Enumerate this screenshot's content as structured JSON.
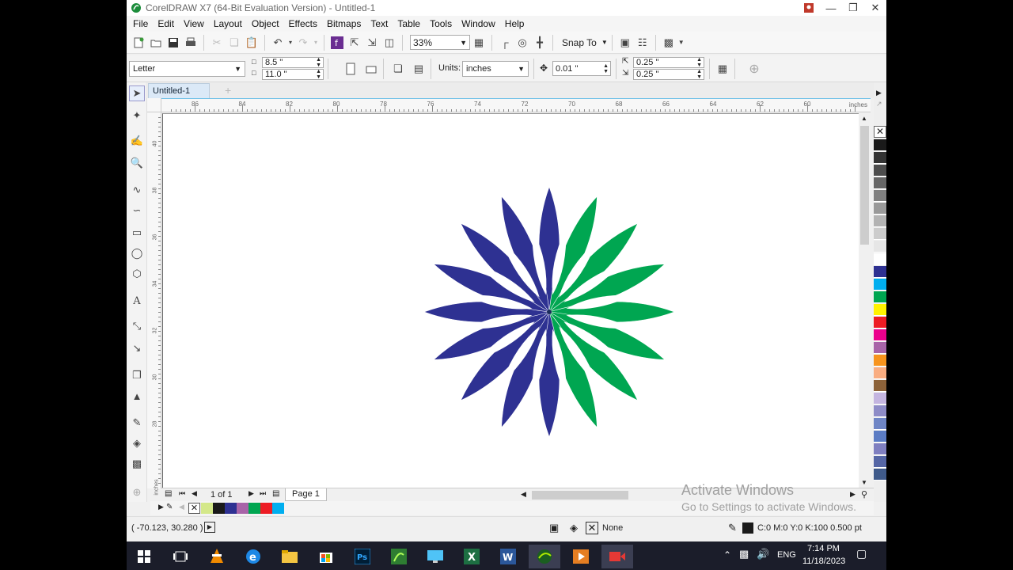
{
  "window": {
    "title": "CorelDRAW X7 (64-Bit Evaluation Version) - Untitled-1"
  },
  "menu": [
    "File",
    "Edit",
    "View",
    "Layout",
    "Object",
    "Effects",
    "Bitmaps",
    "Text",
    "Table",
    "Tools",
    "Window",
    "Help"
  ],
  "toolbar": {
    "zoom": "33%",
    "snap_to": "Snap To"
  },
  "property_bar": {
    "page_size": "Letter",
    "width": "8.5 \"",
    "height": "11.0 \"",
    "units_label": "Units:",
    "units": "inches",
    "nudge": "0.01 \"",
    "dup_x": "0.25 \"",
    "dup_y": "0.25 \""
  },
  "doc_tab": "Untitled-1",
  "ruler": {
    "h_labels": [
      "86",
      "84",
      "82",
      "80",
      "78",
      "76",
      "74",
      "72",
      "70",
      "68",
      "66",
      "64",
      "62",
      "60"
    ],
    "h_unit": "inches",
    "v_labels": [
      "40",
      "38",
      "36",
      "34",
      "32",
      "30",
      "28"
    ],
    "v_unit": "inches"
  },
  "page_nav": {
    "counter": "1 of 1",
    "page_tab": "Page 1"
  },
  "status": {
    "coords": "( -70.123, 30.280 )",
    "fill": "None",
    "outline": "C:0 M:0 Y:0 K:100  0.500 pt"
  },
  "watermark": {
    "line1": "Activate Windows",
    "line2": "Go to Settings to activate Windows."
  },
  "tray": {
    "lang": "ENG",
    "time": "7:14 PM",
    "date": "11/18/2023"
  },
  "colors": {
    "flower_blue": "#2e3192",
    "flower_green": "#00a651",
    "palette": [
      "#1a1a1a",
      "#333333",
      "#4d4d4d",
      "#666666",
      "#808080",
      "#999999",
      "#b3b3b3",
      "#cccccc",
      "#e6e6e6",
      "#ffffff",
      "#2e3192",
      "#00aeef",
      "#00a651",
      "#fff200",
      "#ed1c24",
      "#ec008c",
      "#a864a8",
      "#f7941d",
      "#f9ad81",
      "#8c6239",
      "#c4b5e0",
      "#8e8cc7",
      "#6f86c6",
      "#5b7cc4",
      "#7f7fc0",
      "#5566a5",
      "#3f5a8a"
    ],
    "doc_palette": [
      "#d4e88a",
      "#1a1a1a",
      "#2e3192",
      "#a864a8",
      "#00a651",
      "#ed1c24",
      "#00aeef"
    ]
  }
}
